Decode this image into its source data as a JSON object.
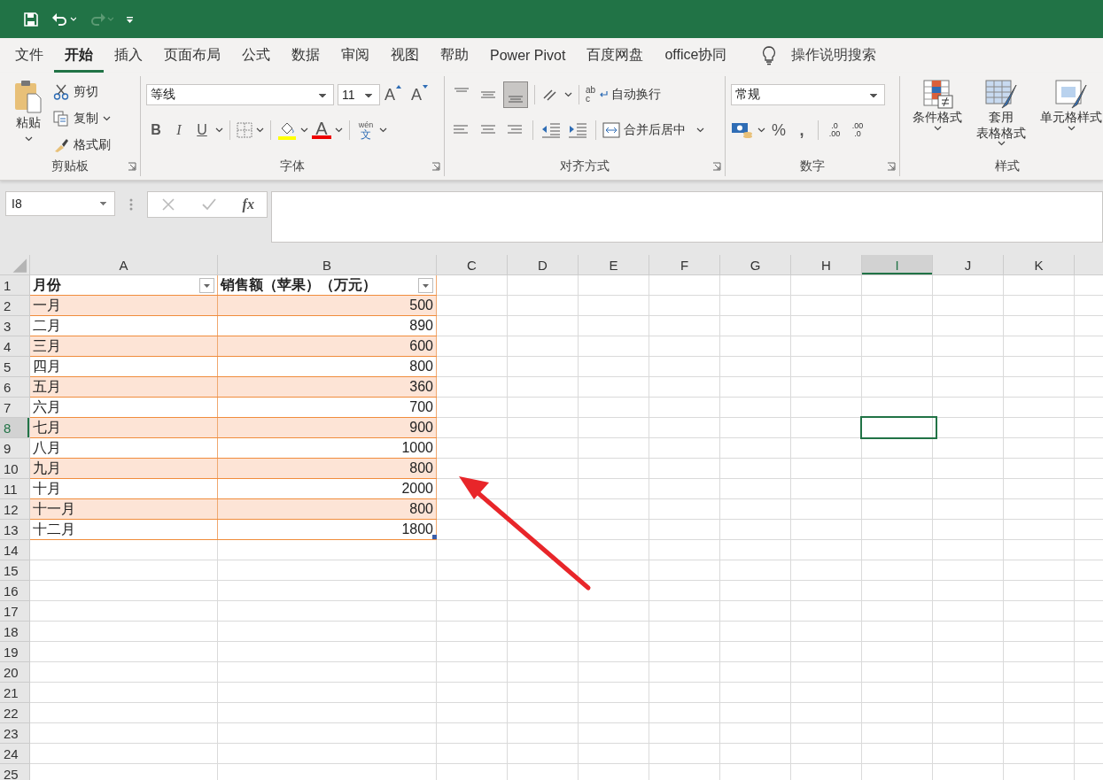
{
  "tabs": [
    {
      "label": "文件",
      "selected": false
    },
    {
      "label": "开始",
      "selected": true
    },
    {
      "label": "插入",
      "selected": false
    },
    {
      "label": "页面布局",
      "selected": false
    },
    {
      "label": "公式",
      "selected": false
    },
    {
      "label": "数据",
      "selected": false
    },
    {
      "label": "审阅",
      "selected": false
    },
    {
      "label": "视图",
      "selected": false
    },
    {
      "label": "帮助",
      "selected": false
    },
    {
      "label": "Power Pivot",
      "selected": false
    },
    {
      "label": "百度网盘",
      "selected": false
    },
    {
      "label": "office协同",
      "selected": false
    }
  ],
  "tell_me": "操作说明搜索",
  "clipboard": {
    "paste": "粘贴",
    "cut": "剪切",
    "copy": "复制",
    "format_painter": "格式刷",
    "label": "剪贴板"
  },
  "font": {
    "name": "等线",
    "size": "11",
    "grow": "A",
    "shrink": "A",
    "styles": [
      "B",
      "I",
      "U"
    ],
    "color_letter": "A",
    "phonetic_top": "wén",
    "phonetic_bottom": "文",
    "label": "字体"
  },
  "alignment": {
    "wrap_top": "ab",
    "wrap_bottom": "c",
    "wrap": "自动换行",
    "merge": "合并后居中",
    "label": "对齐方式"
  },
  "number": {
    "format": "常规",
    "percent": "%",
    "comma": ",",
    "increase_decimal": [
      ".0",
      ".00"
    ],
    "decrease_decimal": [
      ".00",
      ".0"
    ],
    "label": "数字"
  },
  "styles": {
    "buttons": [
      {
        "lines": [
          "条件格式"
        ]
      },
      {
        "lines": [
          "套用",
          "表格格式"
        ]
      },
      {
        "lines": [
          "单元格样式"
        ]
      }
    ],
    "label": "样式"
  },
  "name_box": "I8",
  "fx": "fx",
  "columns": [
    {
      "label": "A",
      "selected": false
    },
    {
      "label": "B",
      "selected": false
    },
    {
      "label": "C",
      "selected": false
    },
    {
      "label": "D",
      "selected": false
    },
    {
      "label": "E",
      "selected": false
    },
    {
      "label": "F",
      "selected": false
    },
    {
      "label": "G",
      "selected": false
    },
    {
      "label": "H",
      "selected": false
    },
    {
      "label": "I",
      "selected": true
    },
    {
      "label": "J",
      "selected": false
    },
    {
      "label": "K",
      "selected": false
    }
  ],
  "row_numbers": [
    {
      "label": "1",
      "selected": false
    },
    {
      "label": "2",
      "selected": false
    },
    {
      "label": "3",
      "selected": false
    },
    {
      "label": "4",
      "selected": false
    },
    {
      "label": "5",
      "selected": false
    },
    {
      "label": "6",
      "selected": false
    },
    {
      "label": "7",
      "selected": false
    },
    {
      "label": "8",
      "selected": true
    },
    {
      "label": "9",
      "selected": false
    },
    {
      "label": "10",
      "selected": false
    },
    {
      "label": "11",
      "selected": false
    },
    {
      "label": "12",
      "selected": false
    },
    {
      "label": "13",
      "selected": false
    },
    {
      "label": "14",
      "selected": false
    },
    {
      "label": "15",
      "selected": false
    },
    {
      "label": "16",
      "selected": false
    },
    {
      "label": "17",
      "selected": false
    },
    {
      "label": "18",
      "selected": false
    },
    {
      "label": "19",
      "selected": false
    },
    {
      "label": "20",
      "selected": false
    },
    {
      "label": "21",
      "selected": false
    },
    {
      "label": "22",
      "selected": false
    },
    {
      "label": "23",
      "selected": false
    },
    {
      "label": "24",
      "selected": false
    },
    {
      "label": "25",
      "selected": false
    }
  ],
  "table": {
    "headers": [
      "月份",
      "销售额（苹果）（万元）"
    ],
    "rows": [
      [
        "一月",
        "500"
      ],
      [
        "二月",
        "890"
      ],
      [
        "三月",
        "600"
      ],
      [
        "四月",
        "800"
      ],
      [
        "五月",
        "360"
      ],
      [
        "六月",
        "700"
      ],
      [
        "七月",
        "900"
      ],
      [
        "八月",
        "1000"
      ],
      [
        "九月",
        "800"
      ],
      [
        "十月",
        "2000"
      ],
      [
        "十一月",
        "800"
      ],
      [
        "十二月",
        "1800"
      ]
    ]
  }
}
